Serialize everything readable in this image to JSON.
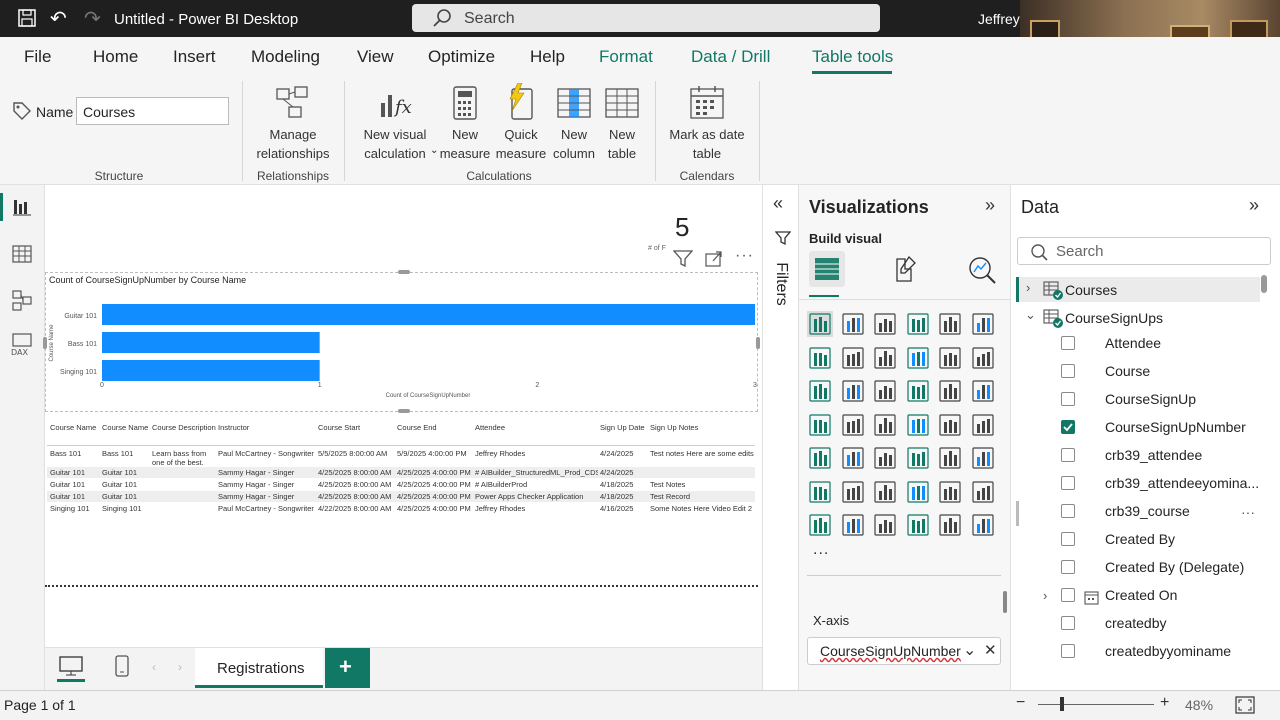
{
  "app": {
    "title": "Untitled - Power BI Desktop",
    "search_label": "Search",
    "user": "Jeffrey"
  },
  "menu": [
    "File",
    "Home",
    "Insert",
    "Modeling",
    "View",
    "Optimize",
    "Help",
    "Format",
    "Data / Drill",
    "Table tools"
  ],
  "ribbon": {
    "name_label": "Name",
    "name_value": "Courses",
    "manage_rel": [
      "Manage",
      "relationships"
    ],
    "new_visual_calc": [
      "New visual",
      "calculation"
    ],
    "new_measure": [
      "New",
      "measure"
    ],
    "quick_measure": [
      "Quick",
      "measure"
    ],
    "new_column": [
      "New",
      "column"
    ],
    "new_table": [
      "New",
      "table"
    ],
    "mark_date": [
      "Mark as date",
      "table"
    ],
    "groups": [
      "Structure",
      "Relationships",
      "Calculations",
      "Calendars"
    ]
  },
  "card": {
    "value": "5",
    "label": "# of F"
  },
  "chart_data": {
    "type": "bar",
    "title": "Count of CourseSignUpNumber by Course Name",
    "xlabel": "Count of CourseSignUpNumber",
    "ylabel": "Course Name",
    "categories": [
      "Guitar 101",
      "Bass 101",
      "Singing 101"
    ],
    "values": [
      3,
      1,
      1
    ],
    "xlim": [
      0,
      3
    ],
    "xticks": [
      "0",
      "1",
      "2",
      "3"
    ],
    "color": "#118dff"
  },
  "table": {
    "headers": [
      "Course Name",
      "Course Name",
      "Course Description",
      "Instructor",
      "Course Start",
      "Course End",
      "Attendee",
      "Sign Up Date",
      "Sign Up Notes"
    ],
    "rows": [
      [
        "Bass 101",
        "Bass 101",
        "Learn bass from one of the best.",
        "Paul McCartney - Songwriter",
        "5/5/2025 8:00:00 AM",
        "5/9/2025 4:00:00 PM",
        "Jeffrey Rhodes",
        "4/24/2025",
        "Test notes Here are some edits"
      ],
      [
        "Guitar 101",
        "Guitar 101",
        "",
        "Sammy Hagar - Singer",
        "4/25/2025 8:00:00 AM",
        "4/25/2025 4:00:00 PM",
        "# AIBuilder_StructuredML_Prod_CDS",
        "4/24/2025",
        ""
      ],
      [
        "Guitar 101",
        "Guitar 101",
        "",
        "Sammy Hagar - Singer",
        "4/25/2025 8:00:00 AM",
        "4/25/2025 4:00:00 PM",
        "# AIBuilderProd",
        "4/18/2025",
        "Test Notes"
      ],
      [
        "Guitar 101",
        "Guitar 101",
        "",
        "Sammy Hagar - Singer",
        "4/25/2025 8:00:00 AM",
        "4/25/2025 4:00:00 PM",
        "Power Apps Checker Application",
        "4/18/2025",
        "Test Record"
      ],
      [
        "Singing 101",
        "Singing 101",
        "",
        "Paul McCartney - Songwriter",
        "4/22/2025 8:00:00 AM",
        "4/25/2025 4:00:00 PM",
        "Jeffrey Rhodes",
        "4/16/2025",
        "Some Notes Here Video Edit 2"
      ]
    ]
  },
  "pages": {
    "tab": "Registrations",
    "status": "Page 1 of 1",
    "zoom": "48%"
  },
  "filters": {
    "label": "Filters"
  },
  "viz": {
    "title": "Visualizations",
    "build": "Build visual",
    "xaxis": "X-axis",
    "xaxis_field": "CourseSignUpNumber",
    "more": "..."
  },
  "data": {
    "title": "Data",
    "search": "Search",
    "tables": [
      "Courses",
      "CourseSignUps"
    ],
    "fields": [
      "Attendee",
      "Course",
      "CourseSignUp",
      "CourseSignUpNumber",
      "crb39_attendee",
      "crb39_attendeeyomina...",
      "crb39_course",
      "Created By",
      "Created By (Delegate)",
      "Created On",
      "createdby",
      "createdbyyominame"
    ],
    "checked": "CourseSignUpNumber"
  }
}
